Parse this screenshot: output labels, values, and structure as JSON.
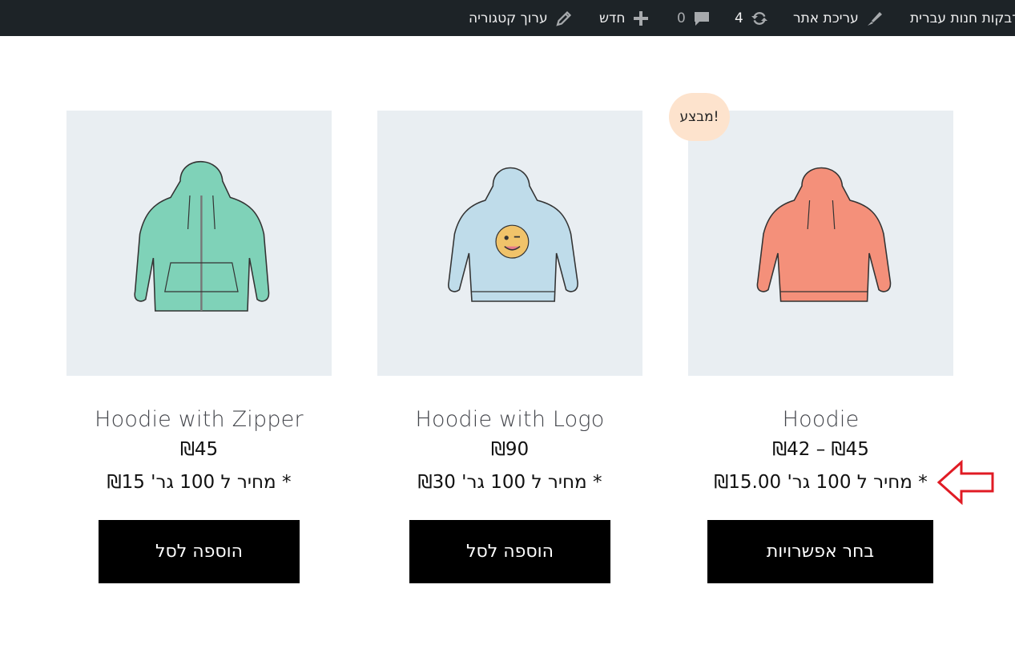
{
  "adminbar": {
    "site_name": "דוגמת מדבקות חנות עברית",
    "customize": "עריכת אתר",
    "updates_count": "4",
    "comments_count": "0",
    "new_label": "חדש",
    "edit_category": "ערוך קטגוריה"
  },
  "products": [
    {
      "name": "Hoodie",
      "price": "₪42 – ₪45",
      "unit_price": "* מחיר ל 100 גר' ₪15.00",
      "button": "בחר אפשרויות",
      "sale_badge": "מבצע!",
      "color": "#f4907a"
    },
    {
      "name": "Hoodie with Logo",
      "price": "₪90",
      "unit_price": "* מחיר ל 100 גר' ₪30",
      "button": "הוספה לסל",
      "color": "#bfdcea"
    },
    {
      "name": "Hoodie with Zipper",
      "price": "₪45",
      "unit_price": "* מחיר ל 100 גר' ₪15",
      "button": "הוספה לסל",
      "color": "#7fd2b8"
    }
  ],
  "annotation": {
    "arrow_color": "#e01b24"
  }
}
